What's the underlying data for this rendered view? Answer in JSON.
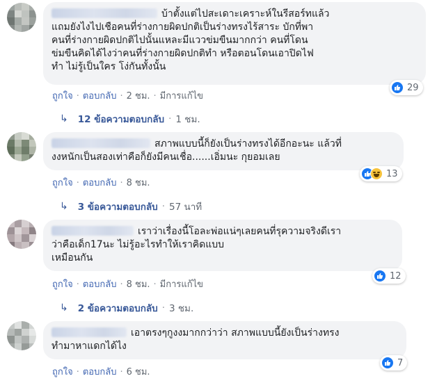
{
  "comments": [
    {
      "text": "บ้าตั้งแต่ไปสะเดาะเคราะห์ในรีสอร์ทแล้ว\nแถมยังไงไปเชือคนที่ร่างกายผิดปกติเป็นร่างทรงไร้สาระ บักที่พา\nคนที่ร่างกายผิดปกติไปนั้นแหละมีแววข่มขืนมากกว่า คนที่โดน\nข่มขืนคิดได้ไงว่าคนที่ร่างกายผิดปกติทำ หรือตอนโดนเอาปิดไฟ\nทำ ไม่รู้เป็นใคร โง่กันทั้งนั้น",
      "reaction_count": "29",
      "like_label": "ถูกใจ",
      "reply_label": "ตอบกลับ",
      "time": "2 ชม.",
      "edited": "มีการแก้ไข",
      "replies_text": "12 ข้อความตอบกลับ",
      "replies_time": "1 ชม."
    },
    {
      "text": "สภาพแบบนี้ก็ยังเป็นร่างทรงได้อีกอะนะ แล้วที่\nงงหนักเป็นสองเท่าคือก็ยังมีคนเชื่อ......เอิ่มนะ กุยอมเลย",
      "reaction_count": "13",
      "like_label": "ถูกใจ",
      "reply_label": "ตอบกลับ",
      "time": "8 ชม.",
      "replies_text": "3 ข้อความตอบกลับ",
      "replies_time": "57 นาที"
    },
    {
      "text": "เราว่าเรื่องนี้โอละพ่อแน่ๆเลยคนที่รุความจริงดีเรา\nว่าคือเด็ก17นะ ไม่รู้อะไรทำให้เราคิดแบบ\nเหมือนกัน",
      "reaction_count": "12",
      "like_label": "ถูกใจ",
      "reply_label": "ตอบกลับ",
      "time": "8 ชม.",
      "edited": "มีการแก้ไข",
      "replies_text": "2 ข้อความตอบกลับ",
      "replies_time": "3 ชม."
    },
    {
      "text": "เอาตรงๆกูงงมากกว่าว่า สภาพแบบนี้ยังเป็นร่างทรง\nทำมาหาแดกได้ไง",
      "reaction_count": "7",
      "like_label": "ถูกใจ",
      "reply_label": "ตอบกลับ",
      "time": "6 ชม."
    }
  ],
  "icons": {
    "like": "like-icon",
    "haha": "haha-icon",
    "reply_arrow": "reply-arrow-icon"
  },
  "colors": {
    "bubble": "#f2f3f5",
    "link": "#4267b2",
    "meta": "#606770",
    "like": "#1877f2"
  }
}
